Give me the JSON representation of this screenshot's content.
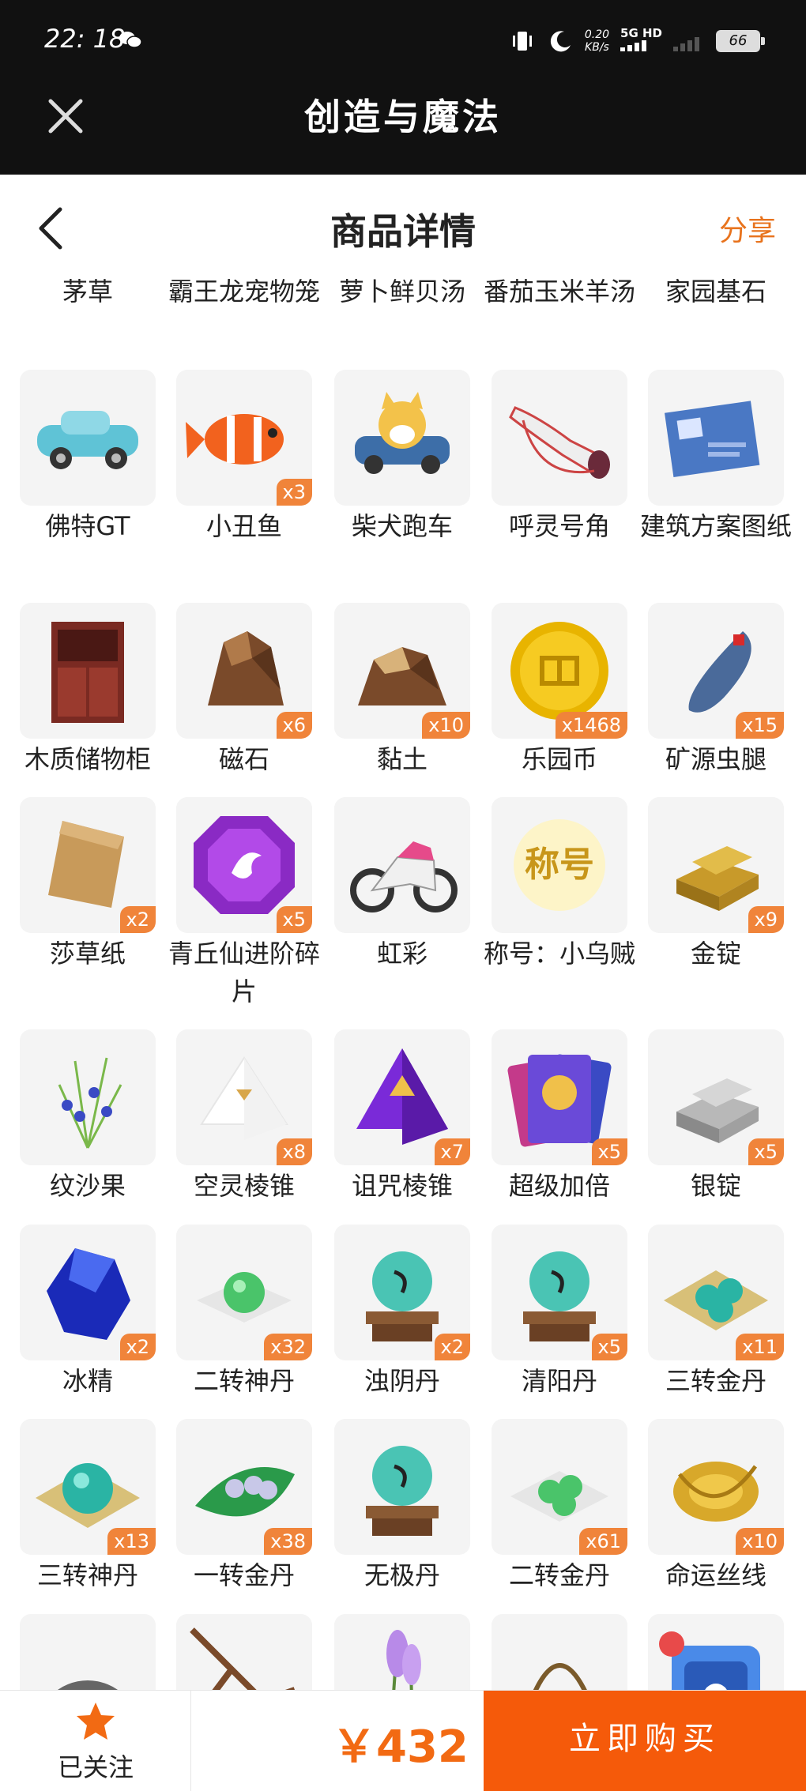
{
  "status": {
    "time": "22: 18",
    "net_speed_top": "0.20",
    "net_speed_unit": "KB/s",
    "network": "5G HD",
    "battery": "66"
  },
  "app": {
    "title": "创造与魔法"
  },
  "header": {
    "title": "商品详情",
    "share_label": "分享"
  },
  "first_row": [
    "茅草",
    "霸王龙宠物笼",
    "萝卜鲜贝汤",
    "番茄玉米羊汤",
    "家园基石"
  ],
  "items": [
    {
      "name": "佛特GT",
      "qty": "",
      "icon": "car-icon"
    },
    {
      "name": "小丑鱼",
      "qty": "x3",
      "icon": "clownfish-icon"
    },
    {
      "name": "柴犬跑车",
      "qty": "",
      "icon": "shiba-car-icon"
    },
    {
      "name": "呼灵号角",
      "qty": "",
      "icon": "horn-icon"
    },
    {
      "name": "建筑方案图纸",
      "qty": "",
      "icon": "blueprint-icon"
    },
    {
      "name": "木质储物柜",
      "qty": "",
      "icon": "cabinet-icon"
    },
    {
      "name": "磁石",
      "qty": "x6",
      "icon": "magnetite-icon"
    },
    {
      "name": "黏土",
      "qty": "x10",
      "icon": "clay-icon"
    },
    {
      "name": "乐园币",
      "qty": "x1468",
      "icon": "coin-icon"
    },
    {
      "name": "矿源虫腿",
      "qty": "x15",
      "icon": "bug-leg-icon"
    },
    {
      "name": "莎草纸",
      "qty": "x2",
      "icon": "papyrus-icon"
    },
    {
      "name": "青丘仙进阶碎片",
      "qty": "x5",
      "icon": "purple-gem-icon"
    },
    {
      "name": "虹彩",
      "qty": "",
      "icon": "motorcycle-icon"
    },
    {
      "name": "称号：小乌贼",
      "qty": "",
      "icon": "title-badge-icon",
      "icon_text": "称号"
    },
    {
      "name": "金锭",
      "qty": "x9",
      "icon": "gold-ingot-icon"
    },
    {
      "name": "纹沙果",
      "qty": "",
      "icon": "plant-icon"
    },
    {
      "name": "空灵棱锥",
      "qty": "x8",
      "icon": "white-pyramid-icon"
    },
    {
      "name": "诅咒棱锥",
      "qty": "x7",
      "icon": "purple-pyramid-icon"
    },
    {
      "name": "超级加倍",
      "qty": "x5",
      "icon": "cards-icon"
    },
    {
      "name": "银锭",
      "qty": "x5",
      "icon": "silver-ingot-icon"
    },
    {
      "name": "冰精",
      "qty": "x2",
      "icon": "ice-crystal-icon"
    },
    {
      "name": "二转神丹",
      "qty": "x32",
      "icon": "green-pill-icon"
    },
    {
      "name": "浊阴丹",
      "qty": "x2",
      "icon": "orb-stand-icon"
    },
    {
      "name": "清阳丹",
      "qty": "x5",
      "icon": "orb-stand-icon"
    },
    {
      "name": "三转金丹",
      "qty": "x11",
      "icon": "teal-pills-icon"
    },
    {
      "name": "三转神丹",
      "qty": "x13",
      "icon": "teal-orb-cloth-icon"
    },
    {
      "name": "一转金丹",
      "qty": "x38",
      "icon": "leaf-pills-icon"
    },
    {
      "name": "无极丹",
      "qty": "",
      "icon": "orb-stand-icon"
    },
    {
      "name": "二转金丹",
      "qty": "x61",
      "icon": "green-pills-icon"
    },
    {
      "name": "命运丝线",
      "qty": "x10",
      "icon": "golden-thread-icon"
    },
    {
      "name": "",
      "qty": "",
      "icon": "rune-stone-icon"
    },
    {
      "name": "",
      "qty": "",
      "icon": "branch-icon"
    },
    {
      "name": "",
      "qty": "",
      "icon": "lavender-icon"
    },
    {
      "name": "",
      "qty": "",
      "icon": "trinket-icon"
    },
    {
      "name": "",
      "qty": "",
      "icon": "pet-tv-icon"
    }
  ],
  "bottom": {
    "follow_label": "已关注",
    "price": "￥432",
    "buy_label": "立即购买"
  },
  "colors": {
    "accent": "#f26a13",
    "buy_bg": "#f55a0a",
    "qty_badge": "#f0843a",
    "topbar": "#111111"
  }
}
